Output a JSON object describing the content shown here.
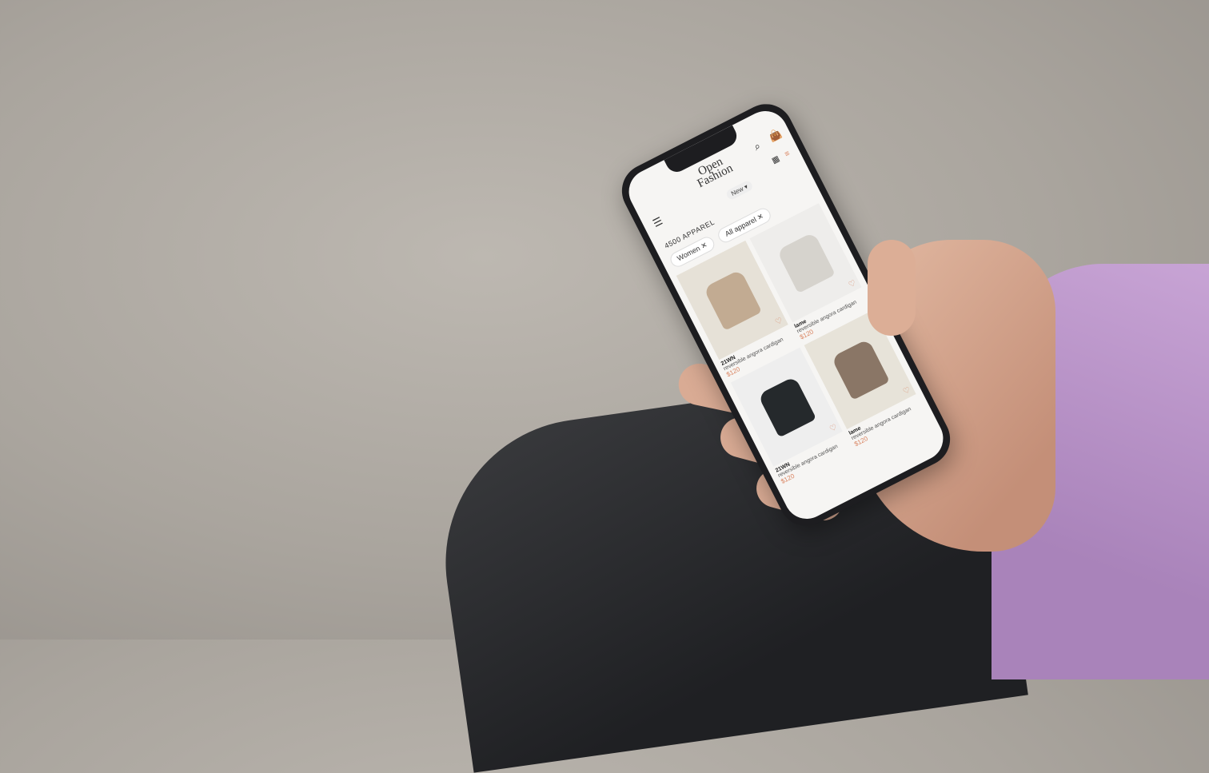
{
  "app": {
    "logo": "Open Fashion"
  },
  "header": {
    "menu_icon": "hamburger-icon",
    "search_icon": "search-icon",
    "bag_icon": "shopping-bag-icon",
    "sort_label": "New ▾",
    "view_icon": "grid-view-icon",
    "filter_icon": "filter-icon"
  },
  "results": {
    "count_label": "4500 APPAREL"
  },
  "filters": [
    {
      "label": "Women ✕"
    },
    {
      "label": "All apparel ✕"
    }
  ],
  "products": [
    {
      "brand": "21WN",
      "name": "reversible angora cardigan",
      "price": "$120",
      "color": "#c2ab92",
      "bg": "#e6e1d7"
    },
    {
      "brand": "lame",
      "name": "reversible angora cardigan",
      "price": "$120",
      "color": "#d6d3cd",
      "bg": "#eeedeb"
    },
    {
      "brand": "21WN",
      "name": "reversible angora cardigan",
      "price": "$120",
      "color": "#25292c",
      "bg": "#eeeeee"
    },
    {
      "brand": "lame",
      "name": "reversible angora cardigan",
      "price": "$120",
      "color": "#8a7666",
      "bg": "#e7e3d9"
    }
  ],
  "colors": {
    "accent": "#d9825e"
  }
}
